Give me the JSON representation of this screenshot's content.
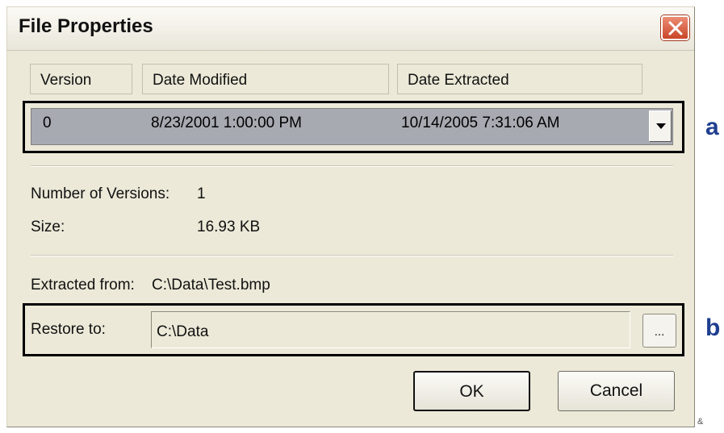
{
  "window": {
    "title": "File Properties",
    "close_icon": "close-icon",
    "close_color": "#d9502f"
  },
  "table": {
    "headers": [
      "Version",
      "Date Modified",
      "Date Extracted"
    ],
    "selected_row": {
      "version": "0",
      "date_modified": "8/23/2001 1:00:00 PM",
      "date_extracted": "10/14/2005 7:31:06 AM"
    },
    "dropdown_icon": "chevron-down-icon"
  },
  "info": {
    "versions_label": "Number of Versions:",
    "versions_value": "1",
    "size_label": "Size:",
    "size_value": "16.93 KB",
    "extracted_label": "Extracted from:",
    "extracted_value": "C:\\Data\\Test.bmp"
  },
  "restore": {
    "label": "Restore to:",
    "value": "C:\\Data",
    "browse_label": "..."
  },
  "buttons": {
    "ok": "OK",
    "cancel": "Cancel"
  },
  "annotations": {
    "a": "a",
    "b": "b",
    "stray": "&"
  },
  "colors": {
    "dialog_bg": "#ece9d8",
    "selected_row_bg": "#a8aab2",
    "annotation": "#1f3f8f",
    "highlight_outline": "#000000"
  }
}
